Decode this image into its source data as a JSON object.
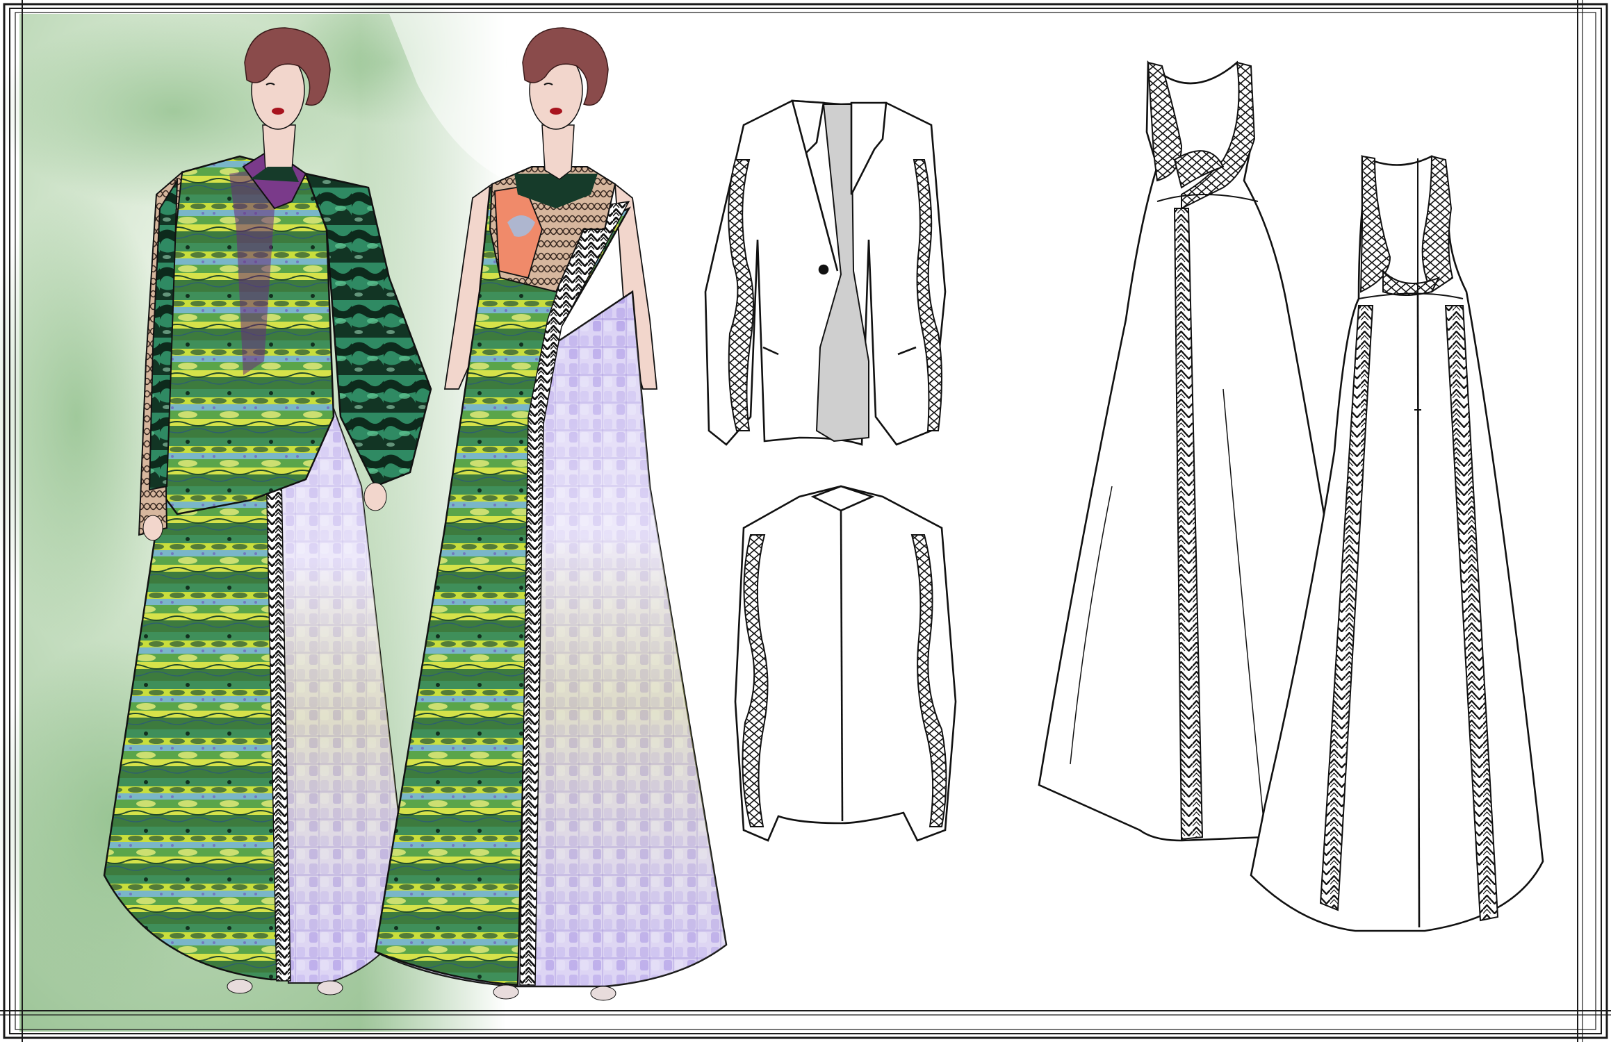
{
  "board": {
    "title": "",
    "colors": {
      "paper": "#ffffff",
      "frame": "#1a1a1a",
      "watercolor_green": "#a9cfa6",
      "print_green": "#6fb84a",
      "print_lime": "#c8dd3a",
      "print_lavender": "#c6b8ee",
      "print_violet": "#8a72d8",
      "skin": "#f2d6cc",
      "hair": "#8a4b4b",
      "lips": "#a8141e",
      "coral_panel": "#f08a6a",
      "dark_emerald": "#163b2a",
      "lining_gray": "#cfcfcf",
      "ink": "#111111"
    },
    "sections": [
      {
        "name": "illustration-look-1",
        "description_icon": "figure-blazer-gown-icon"
      },
      {
        "name": "illustration-look-2",
        "description_icon": "figure-gown-icon"
      },
      {
        "name": "flat-blazer-front",
        "description_icon": "blazer-front-icon"
      },
      {
        "name": "flat-blazer-back",
        "description_icon": "blazer-back-icon"
      },
      {
        "name": "flat-gown-front",
        "description_icon": "gown-front-icon"
      },
      {
        "name": "flat-gown-back",
        "description_icon": "gown-back-icon"
      }
    ]
  }
}
